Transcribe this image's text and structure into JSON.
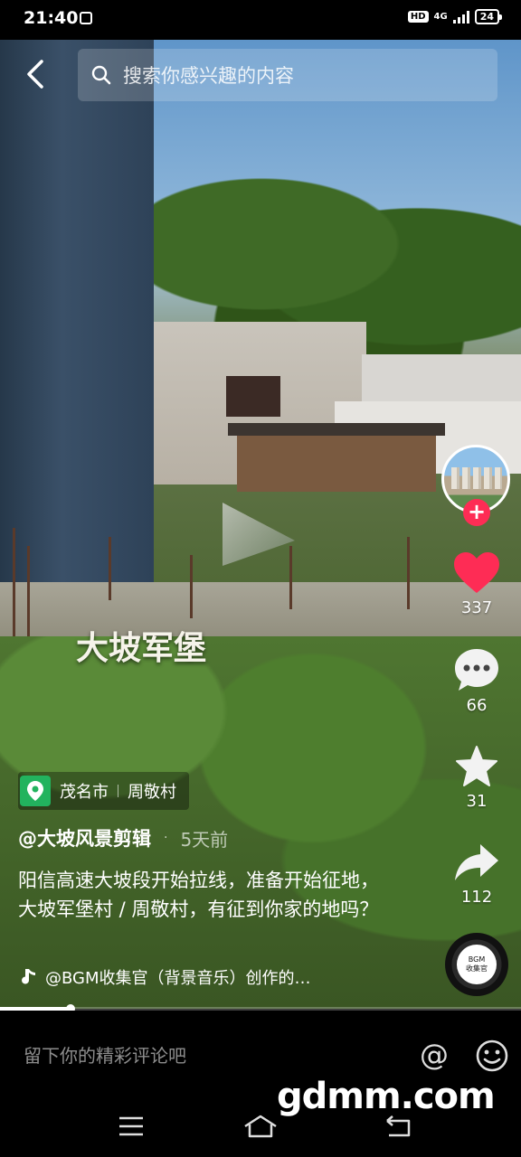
{
  "status_bar": {
    "time": "21:40",
    "hd": "HD",
    "network": "4G",
    "battery": "24"
  },
  "search": {
    "placeholder": "搜索你感兴趣的内容"
  },
  "video": {
    "overlay_caption": "大坡军堡",
    "progress_fraction": 0.135
  },
  "actions": {
    "likes": "337",
    "comments": "66",
    "favorites": "31",
    "shares": "112"
  },
  "location": {
    "city": "茂名市",
    "village": "周敬村"
  },
  "post": {
    "author": "@大坡风景剪辑",
    "time_ago": "5天前",
    "description": "阳信高速大坡段开始拉线，准备开始征地，大坡军堡村 / 周敬村，有征到你家的地吗？",
    "music": "@BGM收集官（背景音乐）创作的…"
  },
  "music_disc": {
    "line1": "BGM",
    "line2": "收集官"
  },
  "comment_bar": {
    "placeholder": "留下你的精彩评论吧",
    "at_symbol": "@"
  },
  "watermark": "gdmm.com",
  "colors": {
    "like_red": "#fe2c55",
    "location_green": "#22b35e"
  },
  "icons": [
    "back-arrow-icon",
    "search-icon",
    "heart-icon",
    "comment-icon",
    "star-icon",
    "share-icon",
    "music-note-icon",
    "location-pin-icon",
    "at-icon",
    "emoji-icon",
    "nav-menu-icon",
    "nav-home-icon",
    "nav-back-icon"
  ]
}
